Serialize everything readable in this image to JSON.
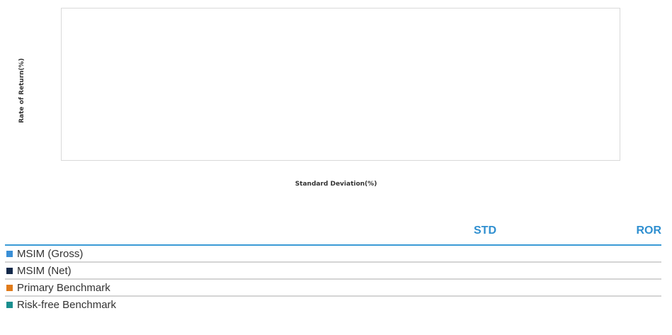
{
  "chart_data": {
    "type": "scatter",
    "xlabel": "Standard Deviation(%)",
    "ylabel": "Rate of Return(%)",
    "series": [
      {
        "name": "MSIM (Gross)",
        "color": "#3a8fd6",
        "points": []
      },
      {
        "name": "MSIM (Net)",
        "color": "#14294a",
        "points": []
      },
      {
        "name": "Primary Benchmark",
        "color": "#e07b1a",
        "points": []
      },
      {
        "name": "Risk-free Benchmark",
        "color": "#1a8f8f",
        "points": []
      }
    ],
    "grid": false
  },
  "table": {
    "columns": [
      "STD",
      "ROR"
    ],
    "rows": [
      {
        "label": "MSIM (Gross)",
        "swatch": "#3a8fd6",
        "std": "",
        "ror": ""
      },
      {
        "label": "MSIM (Net)",
        "swatch": "#14294a",
        "std": "",
        "ror": ""
      },
      {
        "label": "Primary Benchmark",
        "swatch": "#e07b1a",
        "std": "",
        "ror": ""
      },
      {
        "label": "Risk-free Benchmark",
        "swatch": "#1a8f8f",
        "std": "",
        "ror": ""
      }
    ]
  }
}
